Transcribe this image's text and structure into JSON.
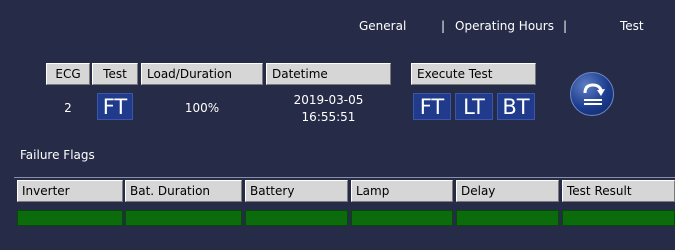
{
  "nav": {
    "tab_general": "General",
    "separator_1": "|",
    "tab_operating_hours": "Operating Hours",
    "separator_2": "|",
    "tab_test": "Test"
  },
  "test_panel": {
    "headers": {
      "ecg": "ECG",
      "test": "Test",
      "load_duration": "Load/Duration",
      "datetime": "Datetime",
      "execute_test": "Execute Test"
    },
    "values": {
      "ecg": "2",
      "test": "FT",
      "load_duration": "100%",
      "date": "2019-03-05",
      "time": "16:55:51"
    },
    "execute_buttons": [
      "FT",
      "LT",
      "BT"
    ],
    "next_icon": "turn-arrow-icon"
  },
  "failure_flags": {
    "label": "Failure Flags",
    "columns": [
      "Inverter",
      "Bat. Duration",
      "Battery",
      "Lamp",
      "Delay",
      "Test Result"
    ],
    "status_color": "#0c6b0c"
  },
  "colors": {
    "background": "#262c48",
    "header_bg": "#d6d6d6",
    "button_bg": "#203a8c",
    "ok_green": "#0c6b0c"
  }
}
